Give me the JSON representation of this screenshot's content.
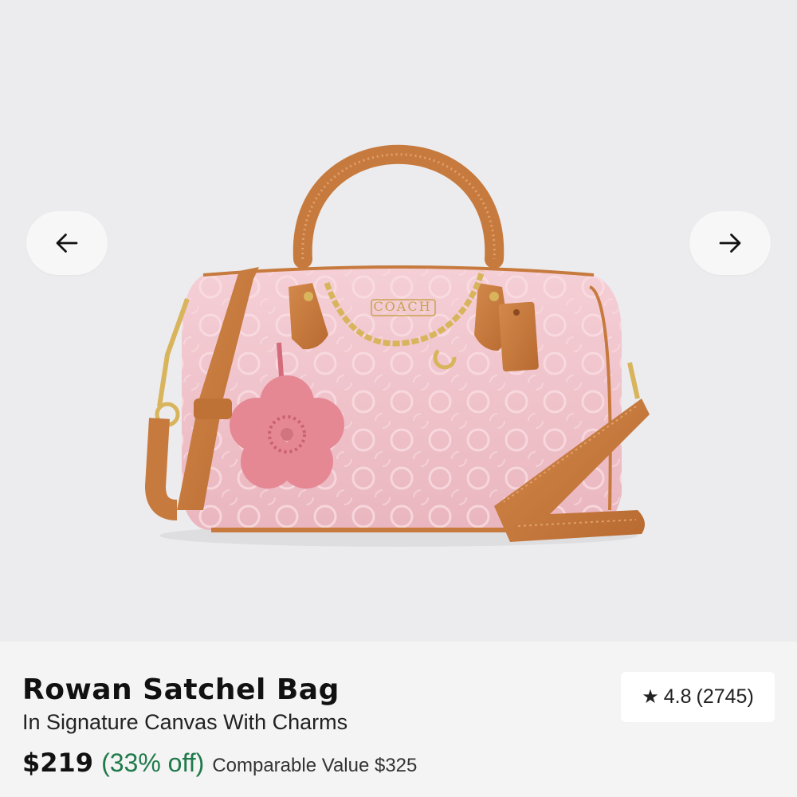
{
  "gallery": {
    "prev_icon": "arrow-left-icon",
    "next_icon": "arrow-right-icon",
    "image_alt": "Rowan Satchel Bag product image"
  },
  "product": {
    "name": "Rowan Satchel Bag",
    "subtitle": "In Signature Canvas With Charms",
    "price": "$219",
    "discount": "(33% off)",
    "comparable": "Comparable Value $325",
    "rating": {
      "icon": "star-icon",
      "value": "4.8",
      "count": "(2745)"
    }
  },
  "colors": {
    "discount_green": "#1f7a4a",
    "bag_pink": "#f1c4cc",
    "leather_tan": "#c77a3e",
    "gold": "#d8b45c"
  }
}
